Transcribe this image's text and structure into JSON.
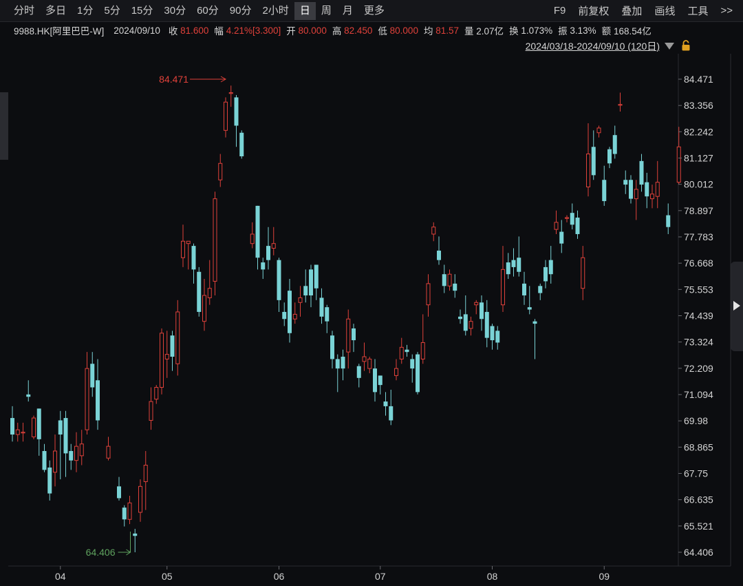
{
  "toolbar": {
    "periods": [
      "分时",
      "多日",
      "1分",
      "5分",
      "15分",
      "30分",
      "60分",
      "90分",
      "2小时",
      "日",
      "周",
      "月",
      "更多"
    ],
    "active_period": "日",
    "right_items": [
      "F9",
      "前复权",
      "叠加",
      "画线",
      "工具",
      ">>"
    ]
  },
  "info": {
    "code": "9988.HK[阿里巴巴-W]",
    "date": "2024/09/10",
    "close_label": "收",
    "close": "81.600",
    "change_label": "幅",
    "change": "4.21%[3.300]",
    "open_label": "开",
    "open": "80.000",
    "high_label": "高",
    "high": "82.450",
    "low_label": "低",
    "low": "80.000",
    "avg_label": "均",
    "avg": "81.57",
    "volume_label": "量",
    "volume": "2.07亿",
    "turnover_label": "换",
    "turnover": "1.073%",
    "amplitude_label": "振",
    "amplitude": "3.13%",
    "amount_label": "额",
    "amount": "168.54亿"
  },
  "range": {
    "text": "2024/03/18-2024/09/10 (120日)"
  },
  "colors": {
    "up": "#e0413a",
    "down": "#7ad3d6",
    "max_annotation": "#e0413a",
    "min_annotation": "#5fa35f",
    "background": "#0c0d10"
  },
  "icons": {
    "range_dropdown": "triangle-down-icon",
    "lock": "lock-icon",
    "expand": "chevron-right-icon"
  },
  "chart_data": {
    "type": "candlestick",
    "ylim": [
      64.406,
      84.471
    ],
    "y_ticks": [
      "84.471",
      "83.356",
      "82.242",
      "81.127",
      "80.012",
      "78.897",
      "77.783",
      "76.668",
      "75.553",
      "74.439",
      "73.324",
      "72.209",
      "71.094",
      "69.98",
      "68.865",
      "67.75",
      "66.635",
      "65.521",
      "64.406"
    ],
    "x_month_labels": [
      {
        "label": "04",
        "index": 9
      },
      {
        "label": "05",
        "index": 29
      },
      {
        "label": "06",
        "index": 50
      },
      {
        "label": "07",
        "index": 69
      },
      {
        "label": "08",
        "index": 90
      },
      {
        "label": "09",
        "index": 111
      }
    ],
    "max_annotation": {
      "label": "84.471",
      "index": 40,
      "value": 84.471
    },
    "min_annotation": {
      "label": "64.406",
      "index": 22,
      "value": 64.406
    },
    "candles": [
      [
        70.1,
        69.4,
        70.6,
        69.1
      ],
      [
        69.4,
        69.6,
        69.9,
        69.1
      ],
      [
        69.5,
        69.5,
        69.9,
        69.1
      ],
      [
        71.1,
        71.0,
        71.7,
        70.8
      ],
      [
        69.3,
        70.1,
        70.2,
        69.2
      ],
      [
        70.5,
        69.2,
        70.5,
        68.5
      ],
      [
        68.7,
        67.9,
        69.0,
        67.8
      ],
      [
        68.0,
        66.9,
        68.3,
        66.6
      ],
      [
        67.8,
        68.7,
        69.4,
        67.2
      ],
      [
        70.0,
        69.4,
        70.4,
        67.5
      ],
      [
        70.1,
        68.6,
        70.4,
        67.6
      ],
      [
        68.7,
        68.3,
        69.0,
        67.9
      ],
      [
        68.3,
        68.9,
        69.5,
        67.8
      ],
      [
        68.5,
        69.0,
        69.6,
        68.1
      ],
      [
        69.6,
        72.2,
        72.9,
        69.4
      ],
      [
        72.4,
        71.4,
        72.9,
        71.0
      ],
      [
        71.7,
        70.0,
        72.6,
        69.6
      ],
      [
        null,
        null,
        null,
        null
      ],
      [
        68.4,
        68.9,
        69.3,
        68.3
      ],
      [
        null,
        null,
        null,
        null
      ],
      [
        67.2,
        66.7,
        67.6,
        66.6
      ],
      [
        66.3,
        65.8,
        66.4,
        65.5
      ],
      [
        65.8,
        66.5,
        66.8,
        65.6
      ],
      [
        65.2,
        65.1,
        65.4,
        64.406
      ],
      [
        66.1,
        67.2,
        67.5,
        65.7
      ],
      [
        67.4,
        68.1,
        68.7,
        66.2
      ],
      [
        70.0,
        70.8,
        71.4,
        69.6
      ],
      [
        70.9,
        71.4,
        71.5,
        70.7
      ],
      [
        71.4,
        73.7,
        73.9,
        71.1
      ],
      [
        72.6,
        72.8,
        73.8,
        71.8
      ],
      [
        73.6,
        72.7,
        73.8,
        72.1
      ],
      [
        72.4,
        74.6,
        75.1,
        71.9
      ],
      [
        76.9,
        77.6,
        78.3,
        76.5
      ],
      [
        77.5,
        77.6,
        77.6,
        76.4
      ],
      [
        77.4,
        76.4,
        77.5,
        75.8
      ],
      [
        76.3,
        74.6,
        76.5,
        74.4
      ],
      [
        74.2,
        75.3,
        76.0,
        73.8
      ],
      [
        75.2,
        75.6,
        76.8,
        74.9
      ],
      [
        75.9,
        79.4,
        79.7,
        75.3
      ],
      [
        80.2,
        80.9,
        81.3,
        79.9
      ],
      [
        82.3,
        83.5,
        83.7,
        82.0
      ],
      [
        83.9,
        83.9,
        84.2,
        83.3
      ],
      [
        83.7,
        82.5,
        83.8,
        81.6
      ],
      [
        82.2,
        81.2,
        82.3,
        81.1
      ],
      [
        null,
        null,
        null,
        null
      ],
      [
        77.5,
        77.9,
        78.4,
        77.3
      ],
      [
        79.1,
        76.9,
        79.1,
        76.4
      ],
      [
        76.7,
        76.4,
        76.9,
        76.0
      ],
      [
        77.4,
        76.8,
        78.2,
        76.4
      ],
      [
        77.3,
        77.5,
        78.2,
        77.0
      ],
      [
        76.8,
        75.1,
        76.9,
        74.6
      ],
      [
        74.6,
        74.3,
        75.0,
        74.0
      ],
      [
        75.5,
        73.7,
        76.0,
        73.3
      ],
      [
        74.3,
        74.5,
        75.0,
        74.1
      ],
      [
        75.0,
        75.2,
        75.7,
        74.4
      ],
      [
        75.7,
        75.3,
        76.4,
        75.0
      ],
      [
        76.4,
        75.3,
        76.6,
        74.8
      ],
      [
        76.6,
        75.6,
        76.6,
        75.1
      ],
      [
        75.2,
        74.4,
        75.6,
        74.1
      ],
      [
        74.8,
        74.2,
        74.9,
        73.7
      ],
      [
        73.6,
        72.6,
        73.8,
        72.2
      ],
      [
        72.6,
        72.2,
        72.8,
        71.2
      ],
      [
        72.7,
        72.2,
        73.0,
        71.7
      ],
      [
        72.9,
        74.3,
        74.7,
        72.2
      ],
      [
        73.9,
        73.4,
        74.1,
        72.9
      ],
      [
        72.3,
        71.8,
        72.4,
        71.4
      ],
      [
        72.5,
        72.7,
        73.3,
        72.1
      ],
      [
        72.2,
        72.6,
        72.7,
        72.0
      ],
      [
        72.2,
        71.2,
        72.6,
        70.8
      ],
      [
        71.9,
        71.5,
        71.9,
        71.1
      ],
      [
        70.8,
        70.6,
        71.2,
        70.2
      ],
      [
        70.6,
        70.0,
        71.3,
        69.8
      ],
      [
        71.9,
        72.2,
        72.6,
        71.7
      ],
      [
        72.6,
        73.1,
        73.5,
        72.4
      ],
      [
        73.0,
        72.9,
        73.2,
        72.7
      ],
      [
        72.6,
        72.2,
        72.8,
        71.6
      ],
      [
        72.8,
        71.2,
        72.9,
        71.1
      ],
      [
        72.6,
        73.3,
        74.5,
        72.4
      ],
      [
        74.9,
        75.8,
        76.2,
        74.4
      ],
      [
        77.9,
        78.2,
        78.4,
        77.6
      ],
      [
        77.2,
        76.8,
        77.8,
        76.6
      ],
      [
        76.2,
        75.7,
        76.6,
        75.4
      ],
      [
        75.7,
        76.2,
        76.4,
        75.5
      ],
      [
        75.8,
        75.5,
        76.2,
        75.2
      ],
      [
        74.4,
        74.3,
        74.7,
        74.1
      ],
      [
        74.5,
        73.8,
        75.3,
        73.6
      ],
      [
        73.9,
        74.2,
        74.4,
        73.6
      ],
      [
        74.9,
        75.0,
        75.1,
        74.5
      ],
      [
        75.0,
        74.3,
        75.3,
        73.8
      ],
      [
        74.6,
        73.5,
        75.1,
        73.1
      ],
      [
        74.0,
        73.4,
        74.1,
        73.0
      ],
      [
        73.8,
        73.3,
        74.0,
        73.0
      ],
      [
        74.9,
        76.4,
        77.4,
        74.6
      ],
      [
        76.7,
        76.2,
        77.1,
        76.0
      ],
      [
        76.8,
        76.5,
        77.3,
        76.1
      ],
      [
        76.9,
        76.3,
        77.8,
        76.1
      ],
      [
        75.8,
        75.3,
        76.3,
        74.9
      ],
      [
        74.8,
        74.7,
        75.7,
        74.5
      ],
      [
        74.2,
        74.1,
        74.3,
        72.6
      ],
      [
        75.7,
        75.4,
        75.8,
        75.1
      ],
      [
        76.5,
        75.9,
        76.8,
        75.6
      ],
      [
        76.8,
        76.2,
        77.4,
        75.8
      ],
      [
        78.1,
        78.4,
        78.9,
        77.9
      ],
      [
        78.0,
        77.5,
        78.5,
        77.1
      ],
      [
        78.6,
        78.6,
        78.7,
        78.4
      ],
      [
        78.8,
        78.3,
        79.2,
        78.1
      ],
      [
        78.6,
        77.9,
        78.9,
        77.7
      ],
      [
        75.6,
        76.9,
        77.4,
        75.1
      ],
      [
        79.9,
        81.3,
        82.6,
        79.5
      ],
      [
        81.6,
        80.4,
        82.3,
        80.2
      ],
      [
        82.2,
        82.4,
        82.5,
        82.0
      ],
      [
        80.2,
        79.3,
        80.8,
        79.1
      ],
      [
        81.5,
        80.9,
        81.6,
        80.7
      ],
      [
        82.1,
        81.3,
        82.5,
        81.1
      ],
      [
        83.4,
        83.4,
        83.9,
        83.1
      ],
      [
        80.2,
        80.0,
        80.6,
        79.6
      ],
      [
        80.2,
        79.4,
        80.4,
        79.2
      ],
      [
        79.4,
        79.8,
        80.2,
        78.5
      ],
      [
        81.0,
        80.0,
        81.3,
        79.7
      ],
      [
        80.1,
        79.5,
        80.5,
        79.0
      ],
      [
        79.4,
        79.6,
        80.0,
        79.0
      ],
      [
        79.5,
        80.1,
        81.0,
        79.0
      ],
      [
        null,
        null,
        null,
        null
      ],
      [
        78.7,
        78.2,
        79.2,
        77.9
      ],
      [
        null,
        null,
        null,
        null
      ],
      [
        80.1,
        81.6,
        82.45,
        80.0
      ]
    ]
  }
}
